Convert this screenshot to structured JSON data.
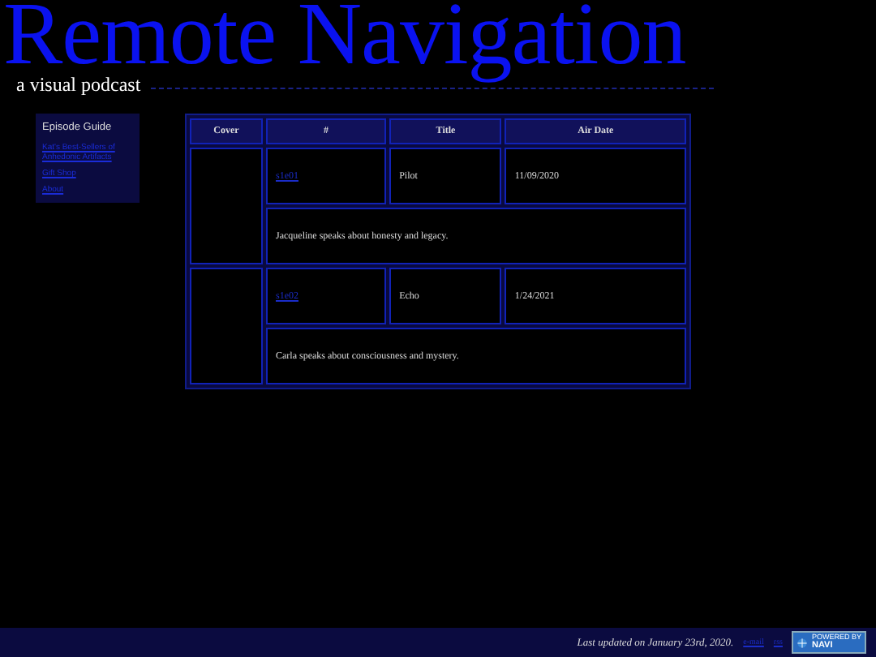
{
  "header": {
    "title": "Remote Navigation",
    "subtitle": "a visual podcast"
  },
  "sidebar": {
    "heading": "Episode Guide",
    "links": [
      "Kat's Best-Sellers of Anhedonic Artifacts",
      "Gift Shop",
      "About"
    ]
  },
  "table": {
    "columns": [
      "Cover",
      "#",
      "Title",
      "Air Date"
    ],
    "rows": [
      {
        "episode": "s1e01",
        "title": "Pilot",
        "air_date": "11/09/2020",
        "description": "Jacqueline speaks about honesty and legacy."
      },
      {
        "episode": "s1e02",
        "title": "Echo",
        "air_date": "1/24/2021",
        "description": "Carla speaks about consciousness and mystery."
      }
    ]
  },
  "footer": {
    "updated": "Last updated on January 23rd, 2020.",
    "links": [
      "e-mail",
      "rss"
    ],
    "badge_top": "POWERED BY",
    "badge_label": "NAVI"
  }
}
